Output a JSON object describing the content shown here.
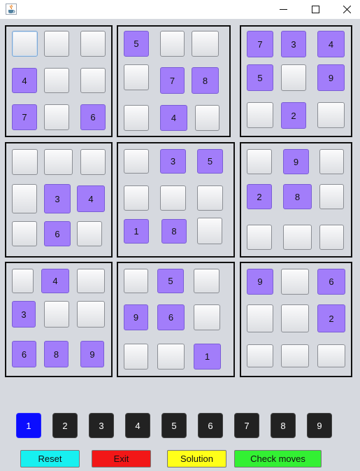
{
  "window": {
    "icon": "java-cup-icon",
    "controls": [
      "minimize-icon",
      "maximize-icon",
      "close-icon"
    ]
  },
  "board": {
    "boxes": [
      {
        "cells": [
          "",
          "",
          "",
          "4",
          "",
          "",
          "7",
          "",
          "6"
        ]
      },
      {
        "cells": [
          "5",
          "",
          "",
          "",
          "7",
          "8",
          "",
          "4",
          ""
        ]
      },
      {
        "cells": [
          "7",
          "3",
          "4",
          "5",
          "",
          "9",
          "",
          "2",
          ""
        ]
      },
      {
        "cells": [
          "",
          "",
          "",
          "",
          "3",
          "4",
          "",
          "6",
          ""
        ]
      },
      {
        "cells": [
          "",
          "3",
          "5",
          "",
          "",
          "",
          "1",
          "8",
          ""
        ]
      },
      {
        "cells": [
          "",
          "9",
          "",
          "2",
          "8",
          "",
          "",
          "",
          ""
        ]
      },
      {
        "cells": [
          "",
          "4",
          "",
          "3",
          "",
          "",
          "6",
          "8",
          "9"
        ]
      },
      {
        "cells": [
          "",
          "5",
          "",
          "9",
          "6",
          "",
          "",
          "",
          "1"
        ]
      },
      {
        "cells": [
          "9",
          "",
          "6",
          "",
          "",
          "2",
          "",
          "",
          ""
        ]
      }
    ],
    "given_color": "#a27dfa",
    "empty_color": "#eceef1"
  },
  "digit_selector": {
    "digits": [
      "1",
      "2",
      "3",
      "4",
      "5",
      "6",
      "7",
      "8",
      "9"
    ],
    "selected": "1",
    "selected_color": "#0b0dff",
    "button_color": "#222222"
  },
  "actions": {
    "reset": {
      "label": "Reset",
      "color": "#17f0f0"
    },
    "exit": {
      "label": "Exit",
      "color": "#f21717"
    },
    "solution": {
      "label": "Solution",
      "color": "#ffff19"
    },
    "check": {
      "label": "Check moves",
      "color": "#33f033"
    }
  }
}
